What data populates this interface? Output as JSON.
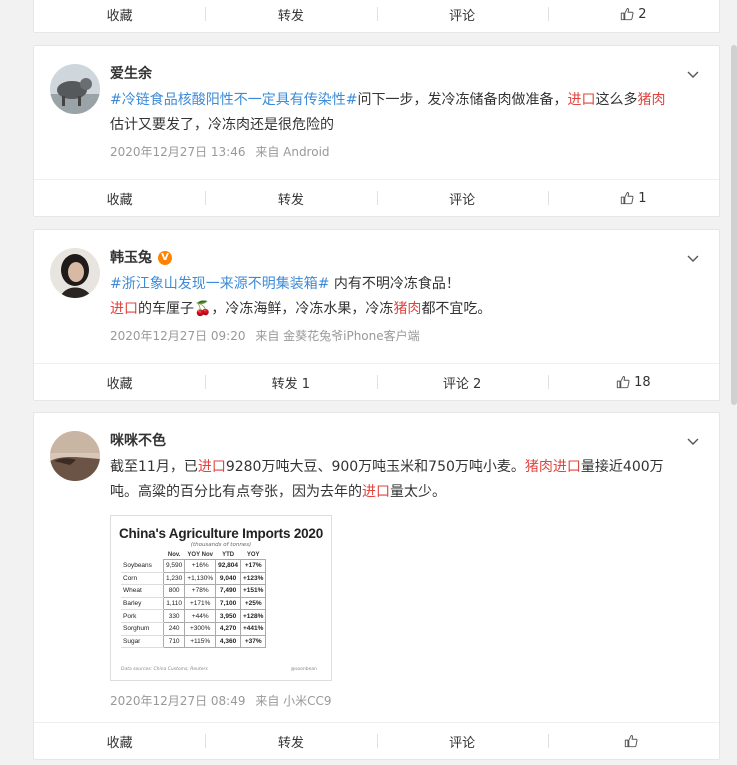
{
  "posts": [
    {
      "actions": {
        "fav": "收藏",
        "repost": "转发",
        "comment": "评论",
        "like": "2"
      }
    },
    {
      "username": "爱生余",
      "text": [
        {
          "t": "#冷链食品核酸阳性不一定具有传染性#",
          "c": "tag"
        },
        {
          "t": "问下一步，发冷冻储备肉做准备，",
          "c": ""
        },
        {
          "t": "进口",
          "c": "kw"
        },
        {
          "t": "这么多",
          "c": ""
        },
        {
          "t": "猪肉",
          "c": "kw"
        },
        {
          "t": "估计又要发了，冷冻肉还是很危险的",
          "c": ""
        }
      ],
      "time": "2020年12月27日 13:46",
      "source": "来自 Android",
      "actions": {
        "fav": "收藏",
        "repost": "转发",
        "comment": "评论",
        "like": "1"
      }
    },
    {
      "username": "韩玉兔",
      "verified": "V",
      "text": [
        {
          "t": "#浙江象山发现一来源不明集装箱#",
          "c": "tag"
        },
        {
          "t": " 内有不明冷冻食品！",
          "c": ""
        },
        {
          "t": "\n",
          "c": "br"
        },
        {
          "t": "进口",
          "c": "kw"
        },
        {
          "t": "的车厘子🍒，冷冻海鲜，冷冻水果，冷冻",
          "c": ""
        },
        {
          "t": "猪肉",
          "c": "kw"
        },
        {
          "t": "都不宜吃。",
          "c": ""
        }
      ],
      "time": "2020年12月27日 09:20",
      "source": "来自 金葵花兔爷iPhone客户端",
      "actions": {
        "fav": "收藏",
        "repost": "转发 1",
        "comment": "评论 2",
        "like": "18"
      }
    },
    {
      "username": "咪咪不色",
      "text": [
        {
          "t": "截至11月，已",
          "c": ""
        },
        {
          "t": "进口",
          "c": "kw"
        },
        {
          "t": "9280万吨大豆、900万吨玉米和750万吨小麦。",
          "c": ""
        },
        {
          "t": "猪肉",
          "c": "kw"
        },
        {
          "t": "进口",
          "c": "kw"
        },
        {
          "t": "量接近400万吨。高粱的百分比有点夸张，因为去年的",
          "c": ""
        },
        {
          "t": "进口",
          "c": "kw"
        },
        {
          "t": "量太少。",
          "c": ""
        }
      ],
      "image": {
        "title": "China's Agriculture Imports 2020",
        "subtitle": "(thousands of tonnes)",
        "columns": [
          "",
          "Nov.",
          "YOY Nov",
          "YTD",
          "YOY"
        ],
        "rows": [
          [
            "Soybeans",
            "9,590",
            "+16%",
            "92,804",
            "+17%"
          ],
          [
            "Corn",
            "1,230",
            "+1,130%",
            "9,040",
            "+123%"
          ],
          [
            "Wheat",
            "800",
            "+78%",
            "7,490",
            "+151%"
          ],
          [
            "Barley",
            "1,110",
            "+171%",
            "7,100",
            "+25%"
          ],
          [
            "Pork",
            "330",
            "+44%",
            "3,950",
            "+128%"
          ],
          [
            "Sorghum",
            "240",
            "+300%",
            "4,270",
            "+441%"
          ],
          [
            "Sugar",
            "710",
            "+115%",
            "4,360",
            "+37%"
          ]
        ],
        "footnote": "Data sources: China Customs, Reuters",
        "credit": "@soonbean"
      },
      "time": "2020年12月27日 08:49",
      "source": "来自 小米CC9",
      "actions": {
        "fav": "收藏",
        "repost": "转发",
        "comment": "评论",
        "like": ""
      }
    }
  ]
}
